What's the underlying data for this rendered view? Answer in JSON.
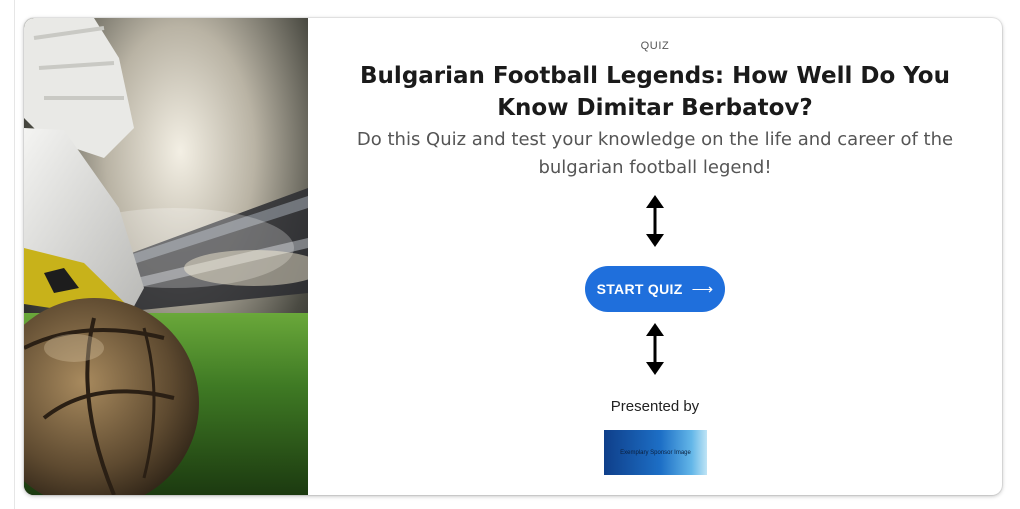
{
  "quiz": {
    "eyebrow": "QUIZ",
    "title": "Bulgarian Football Legends: How Well Do You Know Dimitar Berbatov?",
    "description": "Do this Quiz and test your knowledge on the life and career of the bulgarian football legend!",
    "start_label": "START QUIZ",
    "start_icon": "arrow-right-icon",
    "presented_label": "Presented by",
    "sponsor_label": "Exemplary Sponsor Image"
  },
  "colors": {
    "button": "#1f6fdc",
    "title": "#1a1a1a",
    "description": "#555555"
  },
  "icons": {
    "spacer_arrows": "double-headed-vertical-arrow-icon"
  }
}
